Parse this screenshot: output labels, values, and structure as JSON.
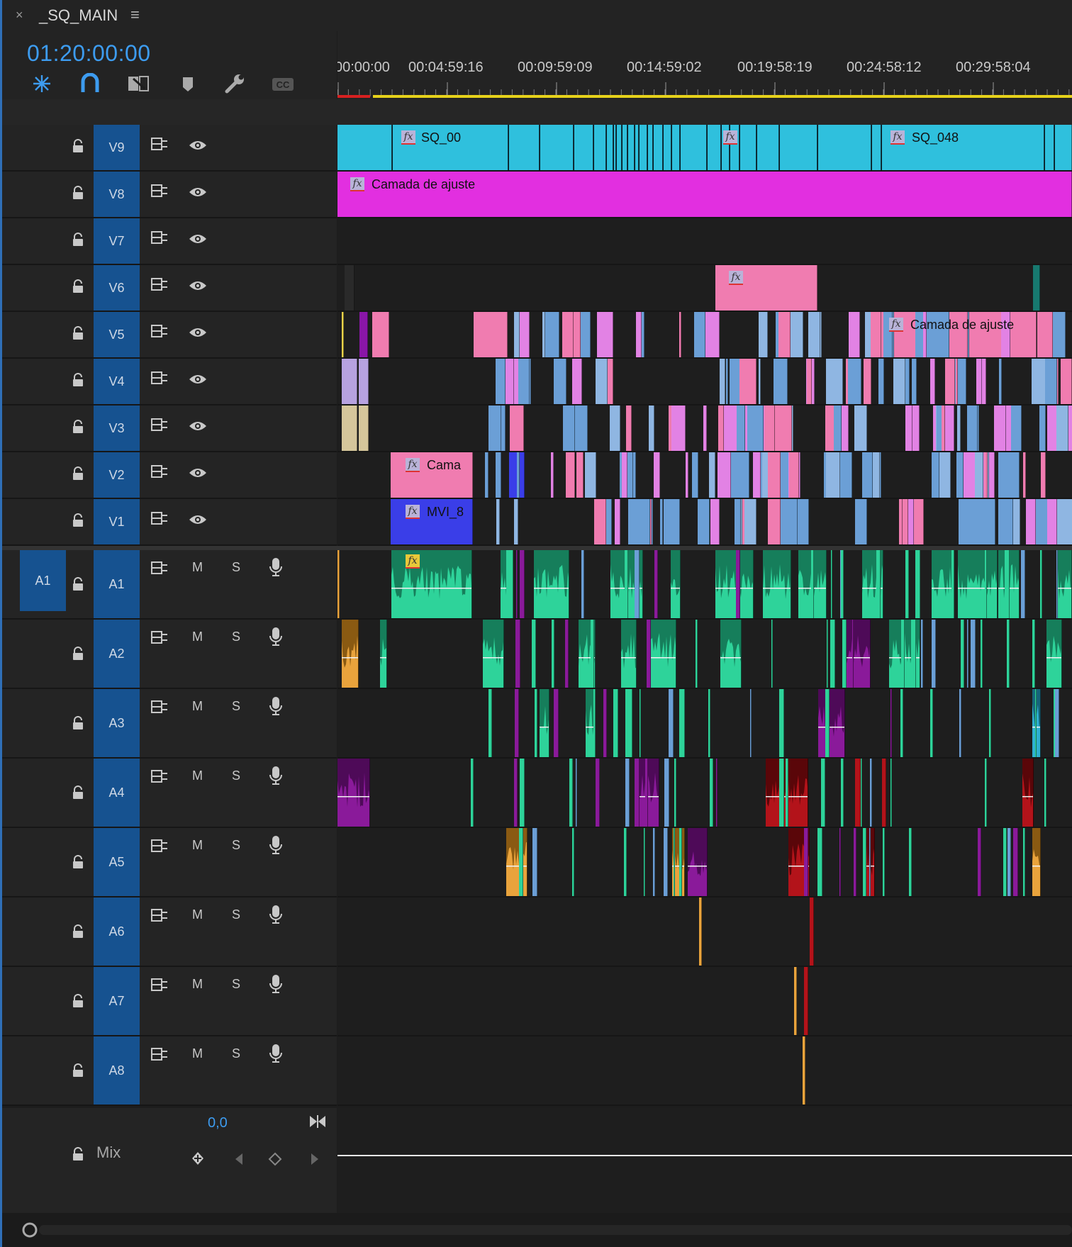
{
  "panel": {
    "close_label": "×",
    "title": "_SQ_MAIN",
    "menu_label": "≡",
    "timecode": "01:20:00:00"
  },
  "toolbar": {
    "tools": [
      "sequence-nest-icon",
      "snap-magnet-icon",
      "linked-selection-icon",
      "add-marker-icon",
      "timeline-settings-wrench-icon",
      "captions-cc-icon"
    ]
  },
  "ruler": {
    "ticks": [
      "00:00:00",
      "00:04:59:16",
      "00:09:59:09",
      "00:14:59:02",
      "00:19:58:19",
      "00:24:58:12",
      "00:29:58:04"
    ]
  },
  "video_tracks": [
    {
      "name": "V9"
    },
    {
      "name": "V8"
    },
    {
      "name": "V7"
    },
    {
      "name": "V6"
    },
    {
      "name": "V5"
    },
    {
      "name": "V4"
    },
    {
      "name": "V3"
    },
    {
      "name": "V2"
    },
    {
      "name": "V1"
    }
  ],
  "audio_tracks": [
    {
      "name": "A1",
      "source_patch": "A1"
    },
    {
      "name": "A2"
    },
    {
      "name": "A3"
    },
    {
      "name": "A4"
    },
    {
      "name": "A5"
    },
    {
      "name": "A6"
    },
    {
      "name": "A7"
    },
    {
      "name": "A8"
    }
  ],
  "audio_buttons": {
    "mute": "M",
    "solo": "S"
  },
  "clip_labels": {
    "v9_a": "SQ_00",
    "v9_b": "SQ_048",
    "v8": "Camada de ajuste",
    "v5": "Camada de ajuste",
    "v2": "Cama",
    "v1": "MVI_8"
  },
  "mix": {
    "label": "Mix",
    "value": "0,0"
  },
  "colors": {
    "accent": "#3d9cf0",
    "track_label_bg": "#165290",
    "clip_cyan": "#2fc0dd",
    "clip_magenta": "#e22fe0",
    "clip_pink": "#f07cb0",
    "clip_blue": "#3a3ee8",
    "clip_steelblue": "#6b9fd6",
    "audio_green": "#2ed39a",
    "audio_purple": "#8a1a9a",
    "audio_orange": "#e9a33c",
    "audio_red": "#b3131a"
  }
}
